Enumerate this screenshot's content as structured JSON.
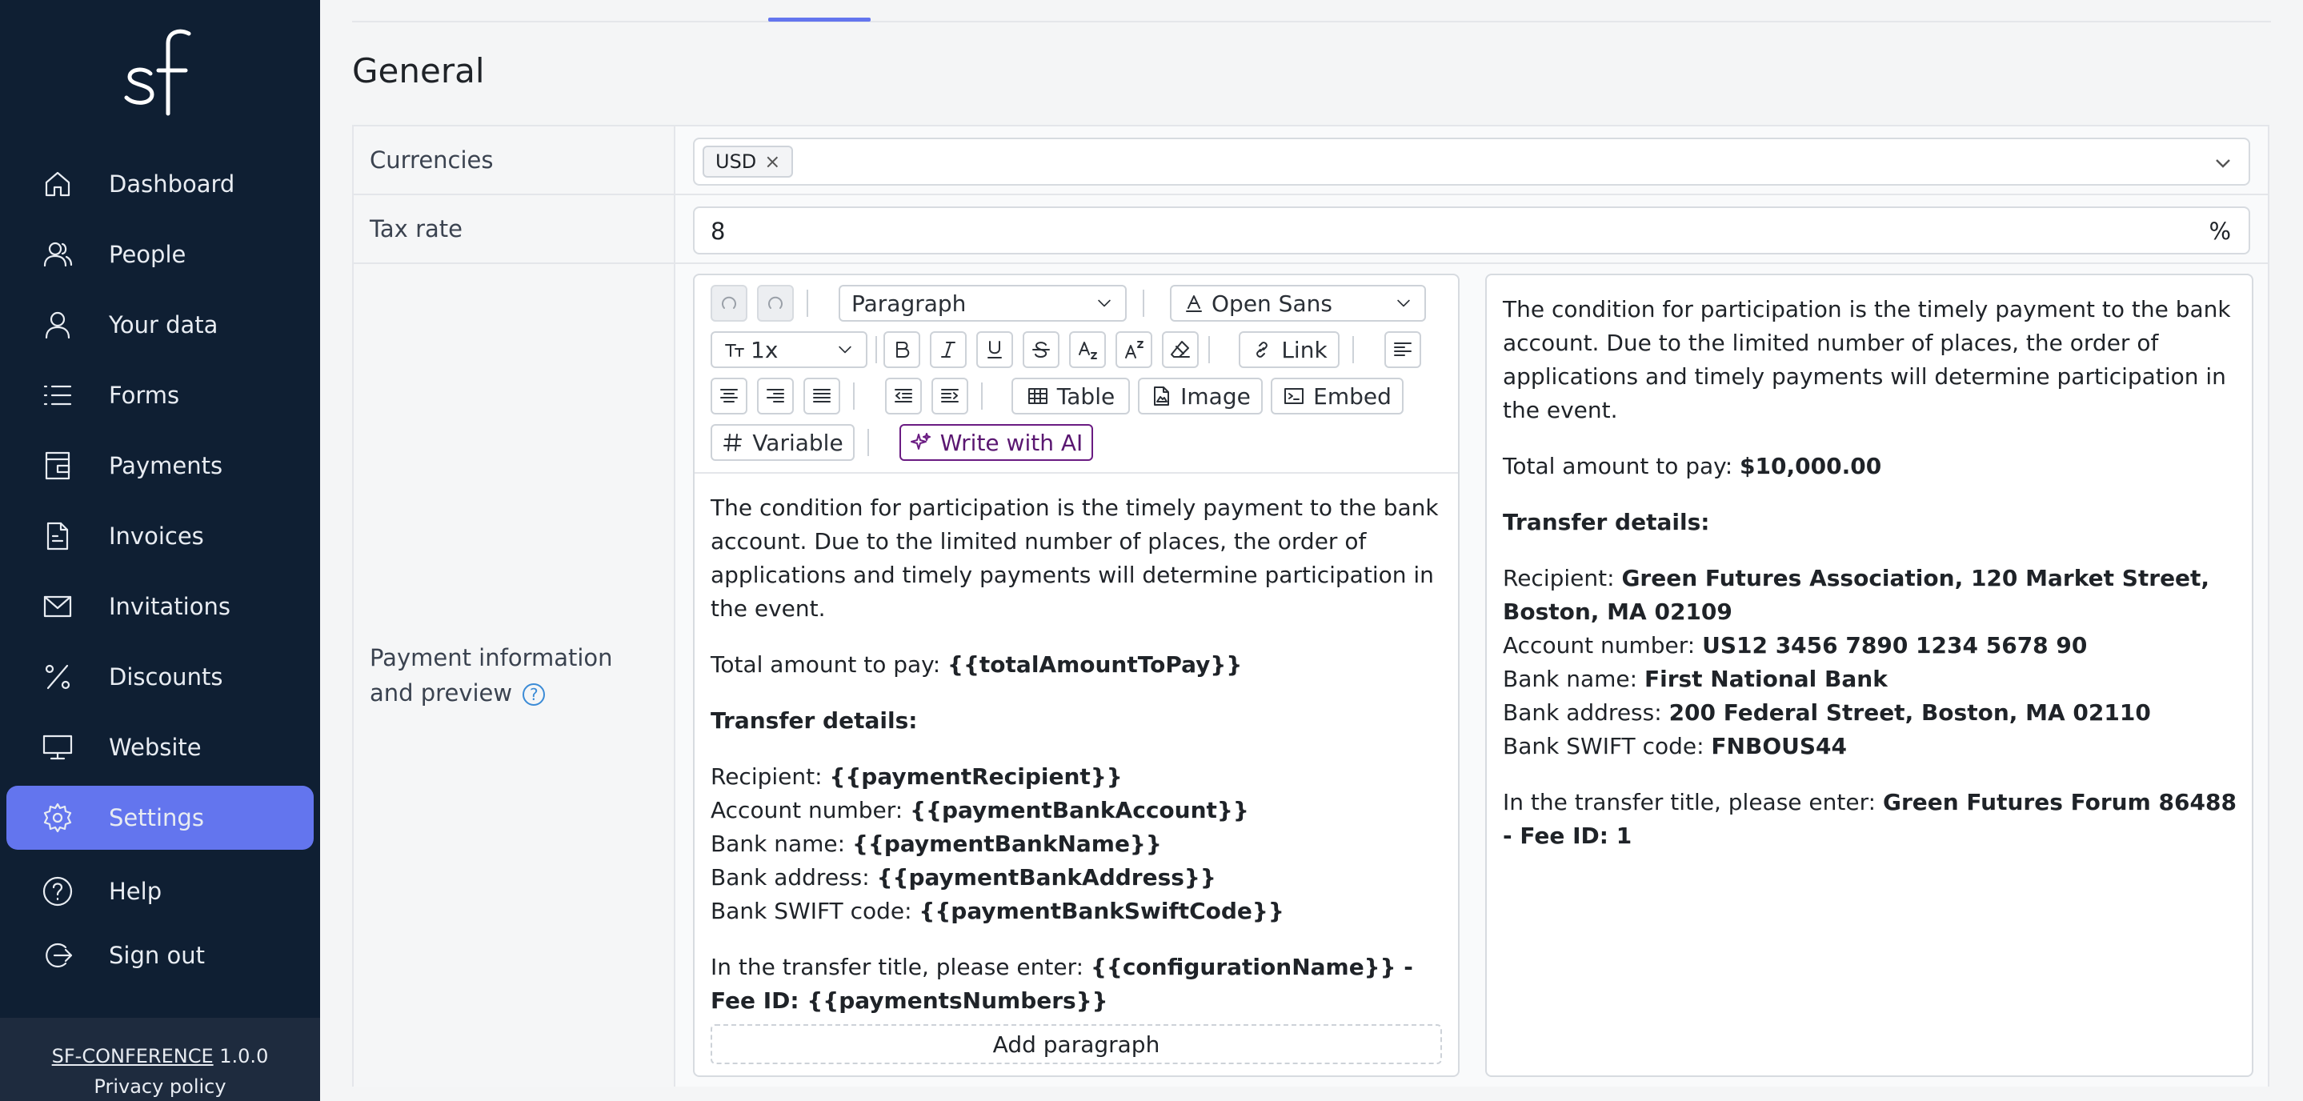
{
  "app": {
    "logo_text": "sf"
  },
  "sidebar": {
    "items": [
      {
        "label": "Dashboard",
        "icon": "home-icon"
      },
      {
        "label": "People",
        "icon": "people-icon"
      },
      {
        "label": "Your data",
        "icon": "user-icon"
      },
      {
        "label": "Forms",
        "icon": "list-icon"
      },
      {
        "label": "Payments",
        "icon": "wallet-icon"
      },
      {
        "label": "Invoices",
        "icon": "document-icon"
      },
      {
        "label": "Invitations",
        "icon": "mail-icon"
      },
      {
        "label": "Discounts",
        "icon": "percent-icon"
      },
      {
        "label": "Website",
        "icon": "monitor-icon"
      },
      {
        "label": "Settings",
        "icon": "gear-icon",
        "active": true
      },
      {
        "label": "Help",
        "icon": "help-icon"
      },
      {
        "label": "Sign out",
        "icon": "sign-out-icon"
      }
    ],
    "footer": {
      "app_name": "SF-CONFERENCE",
      "version": "1.0.0",
      "privacy": "Privacy policy"
    }
  },
  "page": {
    "title": "General"
  },
  "form": {
    "currencies": {
      "label": "Currencies",
      "chip": "USD",
      "chip_remove": "×"
    },
    "tax_rate": {
      "label": "Tax rate",
      "value": "8",
      "suffix": "%"
    },
    "payment": {
      "label": "Payment information and preview",
      "help": "?",
      "toolbar": {
        "block_format": "Paragraph",
        "font": "Open Sans",
        "font_size": "1x",
        "link": "Link",
        "table": "Table",
        "image": "Image",
        "embed": "Embed",
        "variable": "Variable",
        "ai": "Write with AI"
      },
      "editor": {
        "intro": "The condition for participation is the timely payment to the bank account. Due to the limited number of places, the order of applications and timely payments will determine participation in the event.",
        "total_label": "Total amount to pay: ",
        "total_value": "{{totalAmountToPay}}",
        "transfer_heading": "Transfer details:",
        "recipient_label": "Recipient: ",
        "recipient_value": "{{paymentRecipient}}",
        "account_label": "Account number: ",
        "account_value": "{{paymentBankAccount}}",
        "bank_label": "Bank name: ",
        "bank_value": "{{paymentBankName}}",
        "address_label": "Bank address: ",
        "address_value": "{{paymentBankAddress}}",
        "swift_label": "Bank SWIFT code: ",
        "swift_value": "{{paymentBankSwiftCode}}",
        "title_label": "In the transfer title, please enter: ",
        "title_value": "{{configurationName}} - Fee ID: {{paymentsNumbers}}",
        "add_paragraph": "Add paragraph"
      },
      "preview": {
        "intro": "The condition for participation is the timely payment to the bank account. Due to the limited number of places, the order of applications and timely payments will determine participation in the event.",
        "total_label": "Total amount to pay: ",
        "total_value": "$10,000.00",
        "transfer_heading": "Transfer details:",
        "recipient_label": "Recipient: ",
        "recipient_value": "Green Futures Association, 120 Market Street, Boston, MA 02109",
        "account_label": "Account number: ",
        "account_value": "US12 3456 7890 1234 5678 90",
        "bank_label": "Bank name: ",
        "bank_value": "First National Bank",
        "address_label": "Bank address: ",
        "address_value": "200 Federal Street, Boston, MA 02110",
        "swift_label": "Bank SWIFT code: ",
        "swift_value": "FNBOUS44",
        "title_label": "In the transfer title, please enter: ",
        "title_value": "Green Futures Forum 86488 - Fee ID: 1"
      }
    }
  },
  "colors": {
    "sidebar_bg": "#0f1f33",
    "accent": "#6375ee",
    "ai_accent": "#6a1b82"
  }
}
